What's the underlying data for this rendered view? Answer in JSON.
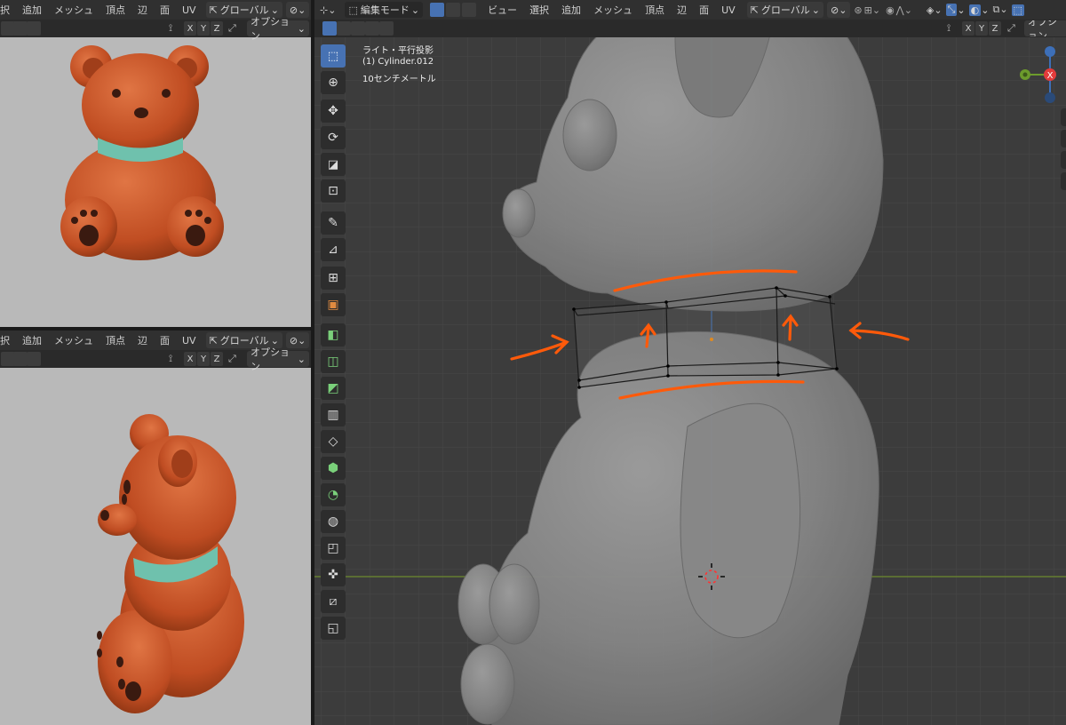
{
  "left_top": {
    "menus": [
      "択",
      "追加",
      "メッシュ",
      "頂点",
      "辺",
      "面",
      "UV"
    ],
    "orientation": "グローバル",
    "axes": [
      "X",
      "Y",
      "Z"
    ],
    "options": "オプション"
  },
  "left_bottom": {
    "menus": [
      "択",
      "追加",
      "メッシュ",
      "頂点",
      "辺",
      "面",
      "UV"
    ],
    "orientation": "グローバル",
    "axes": [
      "X",
      "Y",
      "Z"
    ],
    "options": "オプション"
  },
  "main": {
    "mode": "編集モード",
    "menus": [
      "ビュー",
      "選択",
      "追加",
      "メッシュ",
      "頂点",
      "辺",
      "面",
      "UV"
    ],
    "orientation": "グローバル",
    "axes": [
      "X",
      "Y",
      "Z"
    ],
    "options": "オプション",
    "overlay": {
      "view_name": "ライト・平行投影",
      "object": "(1) Cylinder.012",
      "scale": "10センチメートル"
    },
    "gizmo": {
      "x_label": "X"
    }
  },
  "tools": [
    "select-box",
    "cursor",
    "move",
    "rotate",
    "scale",
    "transform",
    "annotate",
    "measure",
    "add-cube",
    "extrude",
    "extrude-region",
    "inset",
    "bevel",
    "loop-cut",
    "knife",
    "poly-build",
    "spin",
    "smooth",
    "edge-slide",
    "shrink-fatten",
    "shear",
    "rip"
  ],
  "colors": {
    "viewport_bg": "#3c3c3c",
    "left_viewport_bg": "#b9b9b9",
    "accent": "#4772b3",
    "annotation": "#ff5a0a",
    "bear_body": "#c8582a",
    "collar": "#6fc1ad"
  }
}
